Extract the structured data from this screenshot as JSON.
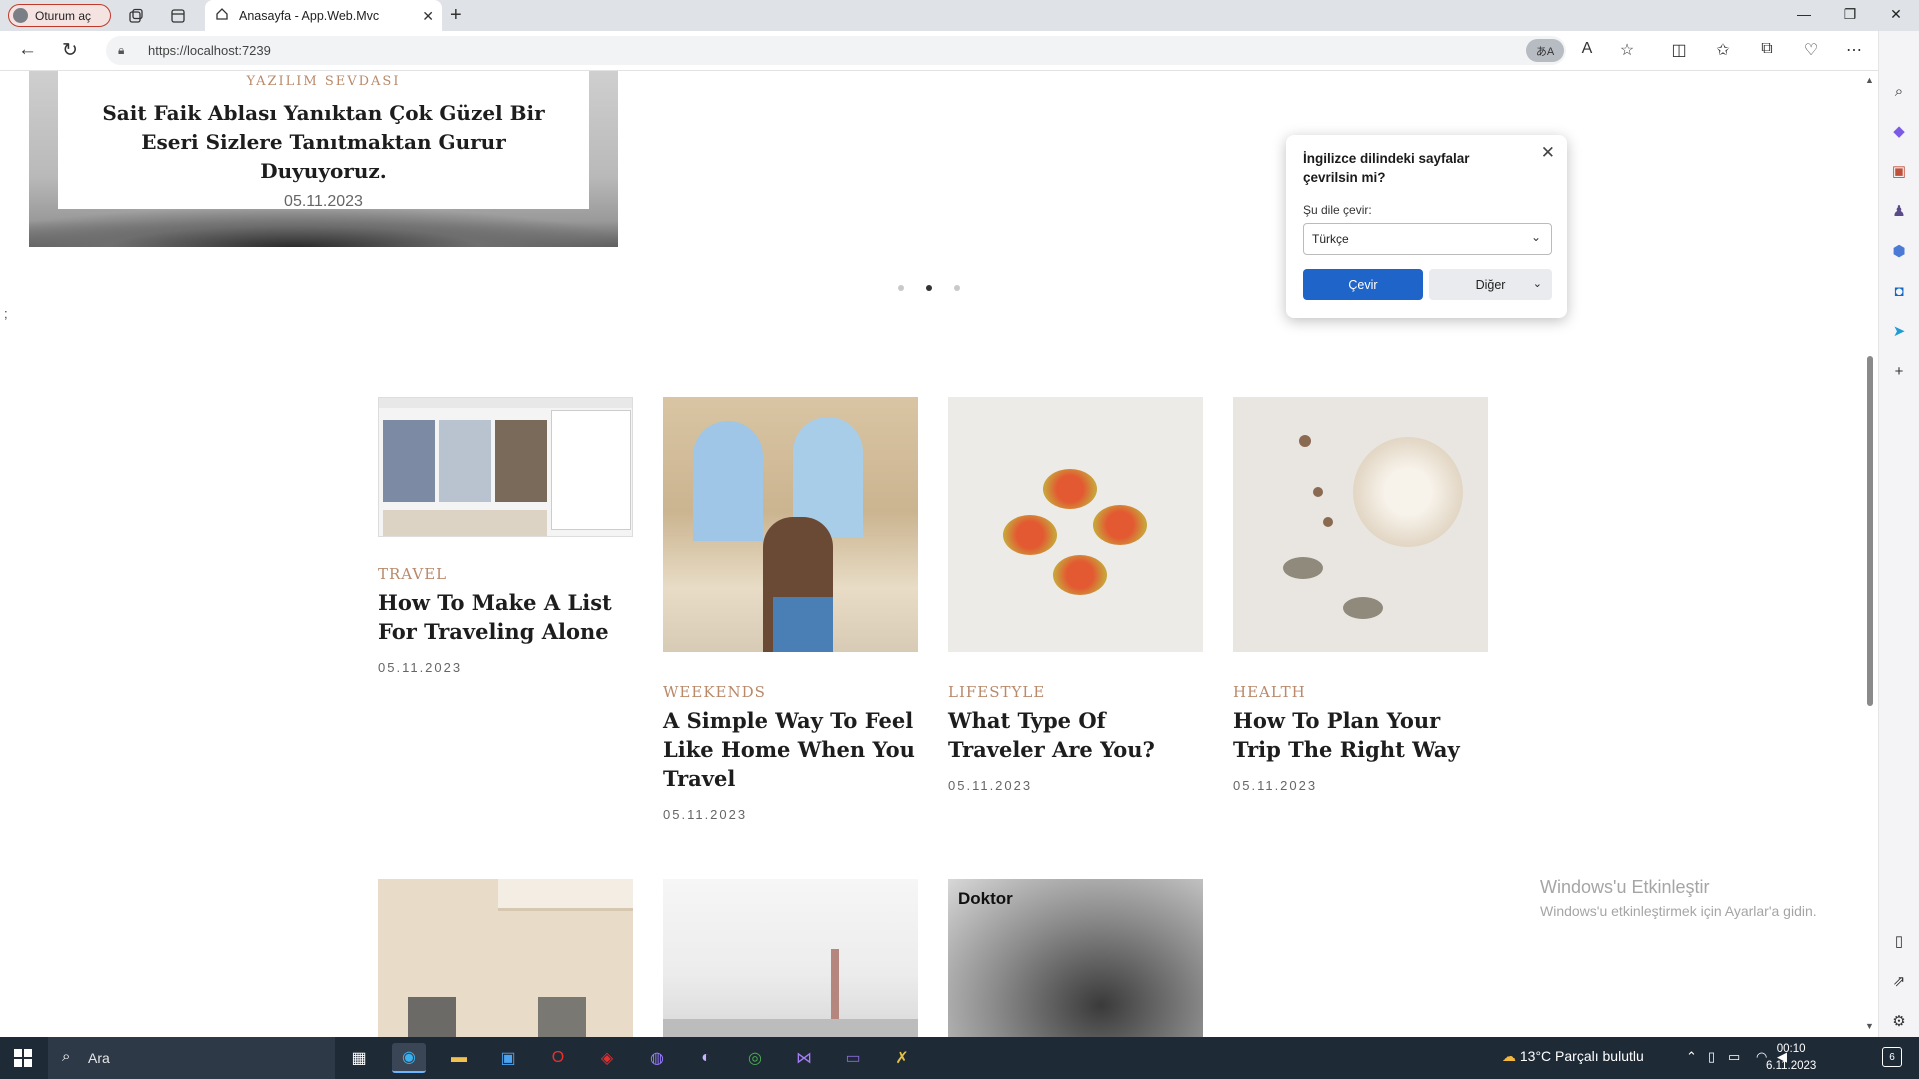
{
  "browser": {
    "profile_label": "Oturum aç",
    "tab_title": "Anasayfa - App.Web.Mvc",
    "url": "https://localhost:7239",
    "translate_chip": "あA"
  },
  "hero": {
    "category": "YAZILIM SEVDASI",
    "title": "Sait Faik Ablası Yanıktan Çok Güzel Bir Eseri Sizlere Tanıtmaktan Gurur Duyuyoruz.",
    "date": "05.11.2023"
  },
  "carousel": {
    "dots": 3,
    "active_index": 1
  },
  "stray_char": ";",
  "posts": [
    {
      "category": "TRAVEL",
      "title": "How To Make A List For Traveling Alone",
      "date": "05.11.2023"
    },
    {
      "category": "WEEKENDS",
      "title": "A Simple Way To Feel Like Home When You Travel",
      "date": "05.11.2023"
    },
    {
      "category": "LIFESTYLE",
      "title": "What Type Of Traveler Are You?",
      "date": "05.11.2023"
    },
    {
      "category": "HEALTH",
      "title": "How To Plan Your Trip The Right Way",
      "date": "05.11.2023"
    }
  ],
  "row2": {
    "portrait_caption": "Doktor"
  },
  "translate_popup": {
    "question": "İngilizce dilindeki sayfalar çevrilsin mi?",
    "target_label": "Şu dile çevir:",
    "selected_language": "Türkçe",
    "translate_button": "Çevir",
    "more_button": "Diğer"
  },
  "watermark": {
    "line1": "Windows'u Etkinleştir",
    "line2": "Windows'u etkinleştirmek için Ayarlar'a gidin."
  },
  "taskbar": {
    "search_placeholder": "Ara",
    "weather": "13°C  Parçalı bulutlu",
    "time": "00:10",
    "date": "6.11.2023",
    "notification_count": "6"
  }
}
